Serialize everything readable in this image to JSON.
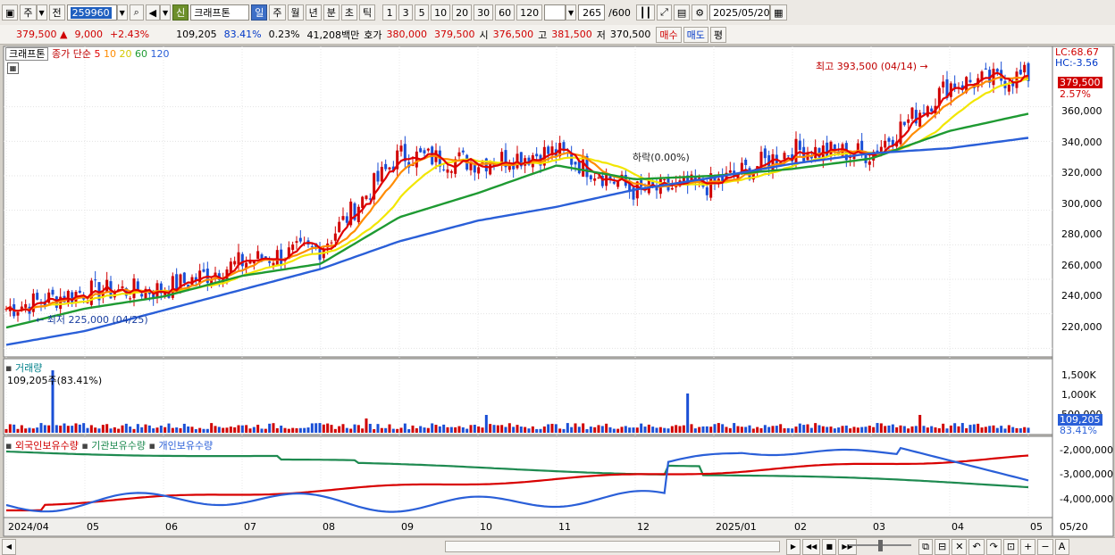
{
  "toolbar": {
    "period_mode": "주",
    "prev_label": "전",
    "code": "259960",
    "badge": "신",
    "stock_name": "크래프톤",
    "periods": [
      "일",
      "주",
      "월",
      "년",
      "분",
      "초",
      "틱"
    ],
    "active_period": "일",
    "ticks": [
      "1",
      "3",
      "5",
      "10",
      "20",
      "30",
      "60",
      "120"
    ],
    "count": "265",
    "total": "/600",
    "date": "2025/05/20"
  },
  "quote": {
    "price": "379,500",
    "change": "9,000",
    "rate": "+2.43%",
    "volume": "109,205",
    "vol_ratio": "83.41%",
    "turnover": "0.23%",
    "amount": "41,208백만",
    "ask_label": "호가",
    "ask": "380,000",
    "bid": "379,500",
    "open_label": "시",
    "open": "376,500",
    "high_label": "고",
    "high": "381,500",
    "low_label": "저",
    "low": "370,500",
    "buy_label": "매수",
    "sell_label": "매도",
    "eval_label": "평"
  },
  "price_panel": {
    "stock_name": "크래프톤",
    "ma_prefix": "종가 단순",
    "ma_labels": [
      "5",
      "10",
      "20",
      "60",
      "120"
    ],
    "lc": "LC:68.67",
    "hc": "HC:-3.56",
    "last_price": "379,500",
    "last_rate": "2.57%",
    "high_note": "최고 393,500 (04/14)",
    "low_note": "최저 225,000 (04/25)",
    "mid_note": "하락(0.00%)",
    "y_ticks": [
      "360,000",
      "340,000",
      "320,000",
      "300,000",
      "280,000",
      "260,000",
      "240,000",
      "220,000"
    ]
  },
  "volume_panel": {
    "title": "거래량",
    "info": "109,205주(83.41%)",
    "y_ticks": [
      "1,500K",
      "1,000K",
      "500,000"
    ],
    "last_volume": "109,205",
    "last_pct": "83.41%"
  },
  "holder_panel": {
    "foreign": "외국인보유수량",
    "institution": "기관보유수량",
    "individual": "개인보유수량",
    "y_ticks": [
      "-2,000,000",
      "-3,000,000",
      "-4,000,000"
    ]
  },
  "x_axis": [
    "2024/04",
    "05",
    "06",
    "07",
    "08",
    "09",
    "10",
    "11",
    "12",
    "2025/01",
    "02",
    "03",
    "04",
    "05",
    "05/20"
  ],
  "colors": {
    "up": "#d00000",
    "down": "#1a4fd6",
    "ma5": "#e00000",
    "ma10": "#ff8c00",
    "ma20": "#f2e600",
    "ma60": "#1e9a32",
    "ma120": "#2a5fd8"
  },
  "chart_data": {
    "type": "line",
    "title": "",
    "x": [
      "2024/04",
      "05",
      "06",
      "07",
      "08",
      "09",
      "10",
      "11",
      "12",
      "2025/01",
      "02",
      "03",
      "04",
      "05"
    ],
    "series": [
      {
        "name": "5",
        "values": [
          243000,
          253000,
          254000,
          270000,
          278000,
          332000,
          328000,
          334000,
          311000,
          315000,
          335000,
          333000,
          373000,
          378000
        ]
      },
      {
        "name": "60",
        "values": [
          232000,
          243000,
          250000,
          262000,
          269000,
          296000,
          310000,
          326000,
          318000,
          320000,
          324000,
          330000,
          346000,
          356000
        ]
      },
      {
        "name": "120",
        "values": [
          222000,
          230000,
          242000,
          254000,
          266000,
          282000,
          294000,
          302000,
          312000,
          319000,
          327000,
          333000,
          336000,
          342000
        ]
      }
    ],
    "ylim": [
      215000,
      395000
    ]
  }
}
